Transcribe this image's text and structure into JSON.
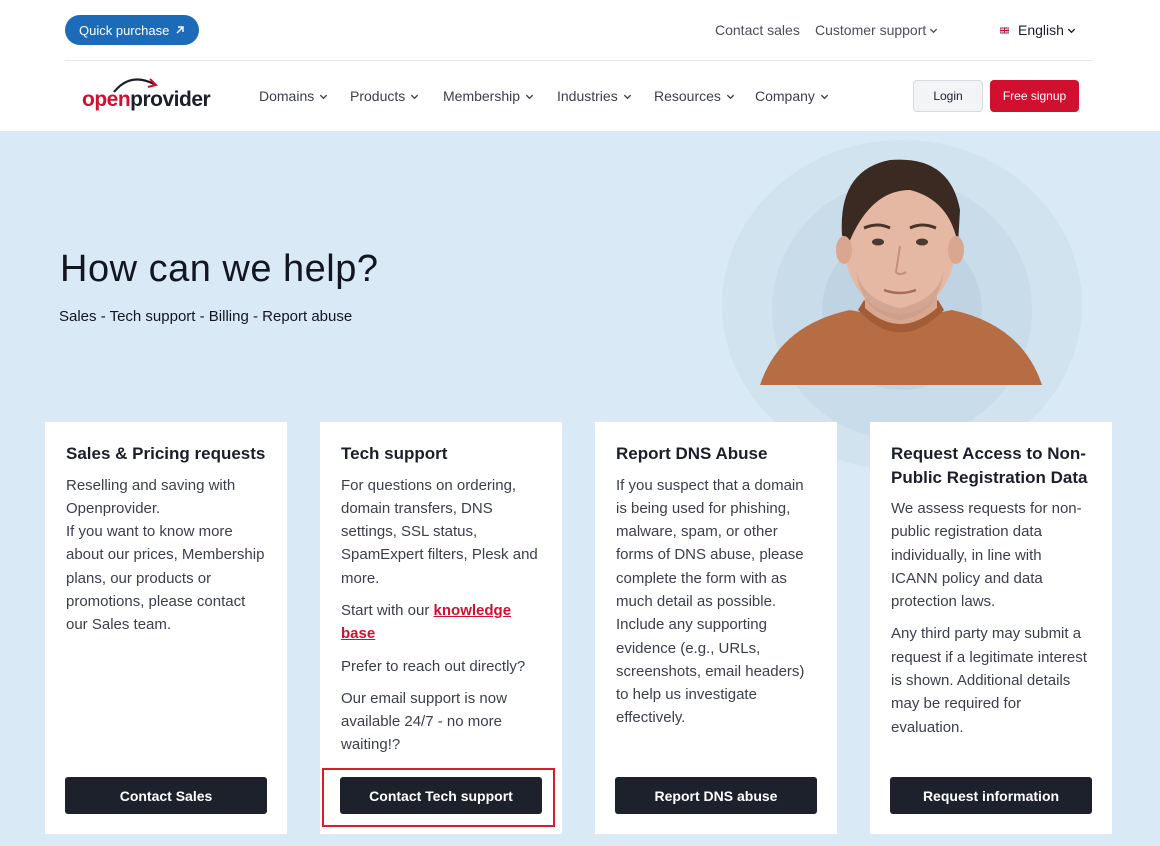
{
  "topbar": {
    "quick_purchase": "Quick purchase",
    "contact_sales": "Contact sales",
    "customer_support": "Customer support",
    "language": "English"
  },
  "brand": {
    "logo_part1": "open",
    "logo_part2": "provider"
  },
  "nav": {
    "items": [
      "Domains",
      "Products",
      "Membership",
      "Industries",
      "Resources",
      "Company"
    ],
    "login": "Login",
    "signup": "Free signup"
  },
  "hero": {
    "title": "How can we help?",
    "subtitle": "Sales - Tech support - Billing - Report abuse"
  },
  "cards": [
    {
      "title": "Sales & Pricing requests",
      "paragraphs": [
        "Reselling and saving with Openprovider.",
        "If you want to know more about our prices, Membership plans, our products or promotions, please contact our Sales team."
      ],
      "button": "Contact Sales"
    },
    {
      "title": "Tech support",
      "p1": "For questions on ordering, domain transfers, DNS settings, SSL status, SpamExpert filters, Plesk and more.",
      "p2_prefix": "Start with our ",
      "p2_link": "knowledge base",
      "p3": "Prefer to reach out directly?",
      "p4": "Our email support is now available 24/7 - no more waiting!?",
      "button": "Contact Tech support"
    },
    {
      "title": "Report DNS Abuse",
      "p1": "If you suspect that a domain is being used for phishing, malware, spam, or other forms of DNS abuse, please complete the form with as much detail as possible. Include any supporting evidence (e.g., URLs, screenshots, email headers) to help us investigate effectively.",
      "button": "Report DNS abuse"
    },
    {
      "title": "Request Access to Non-Public Registration Data",
      "p1": "We assess requests for non-public registration data individually, in line with ICANN policy and data protection laws.",
      "p2": "Any third party may submit a request if a legitimate interest is shown. Additional details may be required for evaluation.",
      "button": "Request information"
    }
  ],
  "colors": {
    "brand_red": "#d1102f",
    "dark_button": "#1c212c",
    "hero_bg": "#d9e9f5",
    "quick_blue": "#1c6bb8"
  }
}
